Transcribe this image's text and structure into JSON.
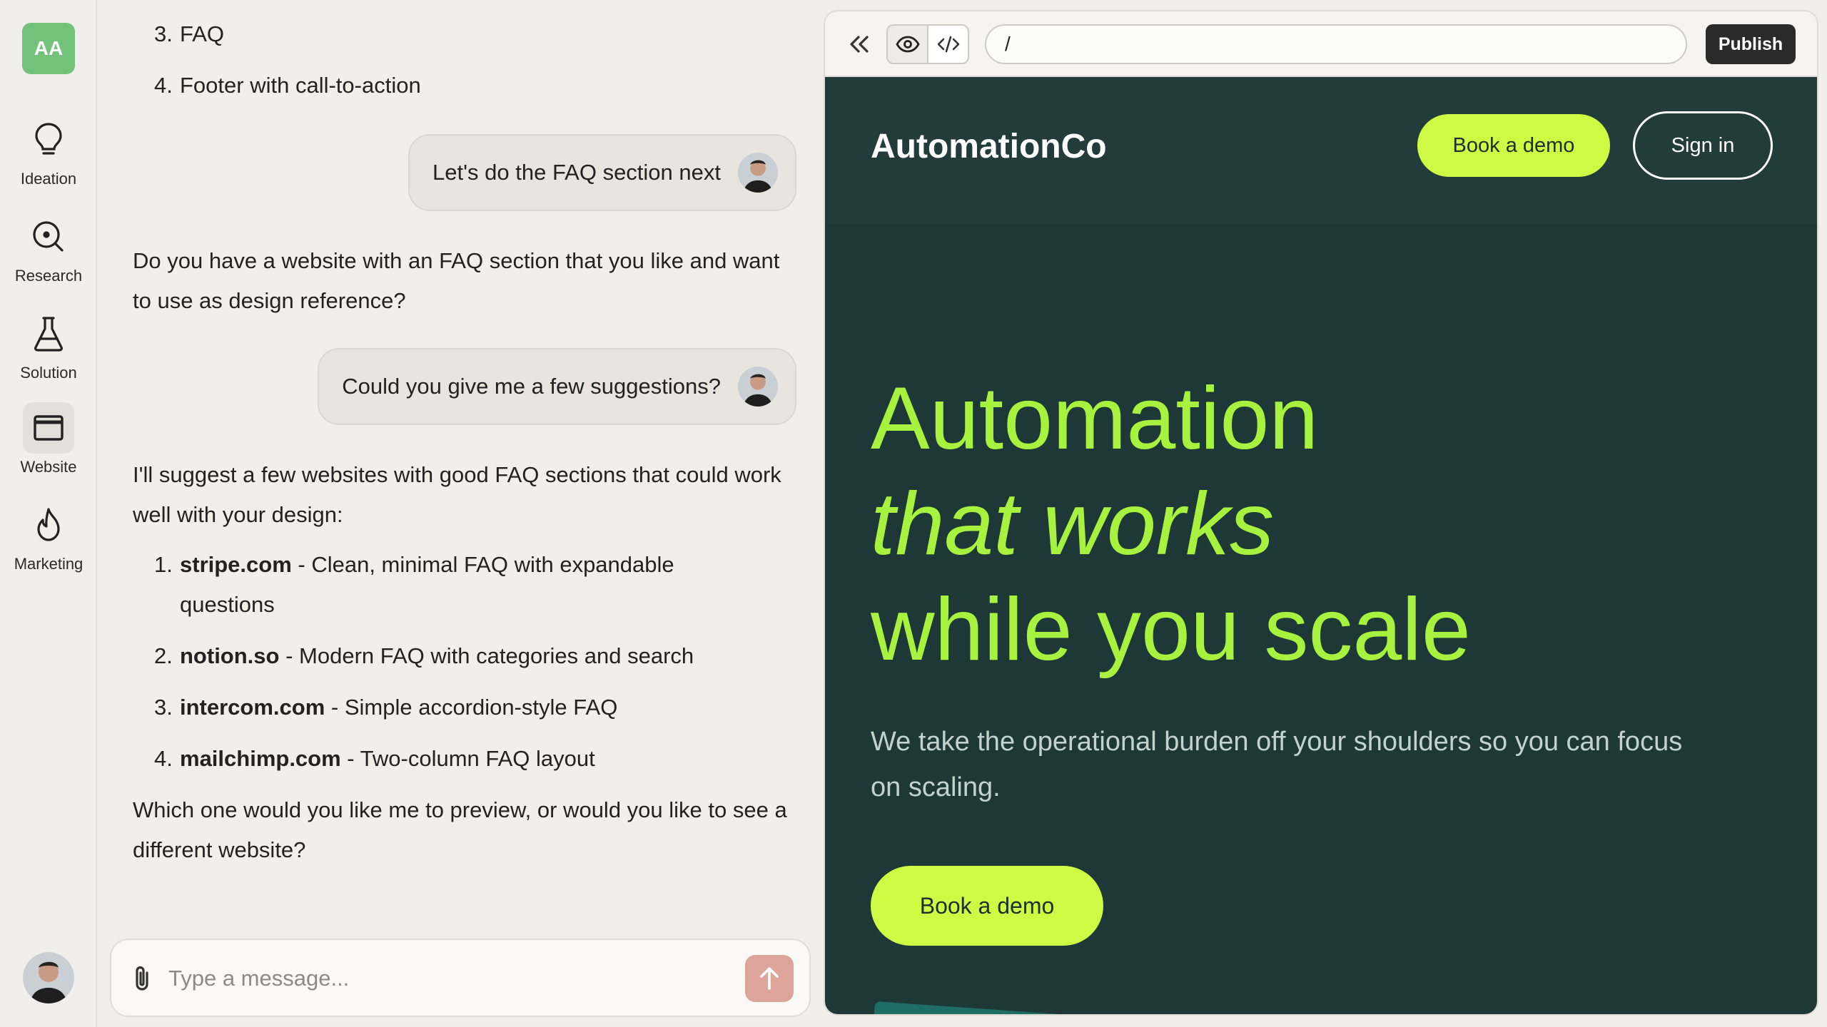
{
  "app": {
    "avatar_initials": "AA",
    "nav": [
      {
        "label": "Ideation",
        "icon": "lightbulb-icon"
      },
      {
        "label": "Research",
        "icon": "search-icon"
      },
      {
        "label": "Solution",
        "icon": "flask-icon"
      },
      {
        "label": "Website",
        "icon": "browser-window-icon",
        "active": true
      },
      {
        "label": "Marketing",
        "icon": "flame-icon"
      }
    ]
  },
  "chat": {
    "top_list": [
      {
        "num": "3.",
        "text": "FAQ"
      },
      {
        "num": "4.",
        "text": "Footer with call-to-action"
      }
    ],
    "user_msg_1": "Let's do the FAQ section next",
    "assistant_msg_1": "Do you have a website with an FAQ section that you like and want to use as design reference?",
    "user_msg_2": "Could you give me a few suggestions?",
    "assistant_msg_2": "I'll suggest a few websites with good FAQ sections that could work well with your design:",
    "suggestions": [
      {
        "num": "1.",
        "site": "stripe.com",
        "desc": " - Clean, minimal FAQ with expandable",
        "desc2": "questions"
      },
      {
        "num": "2.",
        "site": "notion.so",
        "desc": " - Modern FAQ with categories and search"
      },
      {
        "num": "3.",
        "site": "intercom.com",
        "desc": " - Simple accordion-style FAQ"
      },
      {
        "num": "4.",
        "site": "mailchimp.com",
        "desc": " - Two-column FAQ layout"
      }
    ],
    "assistant_msg_3": "Which one would you like me to preview, or would you like to see a different website?",
    "composer_placeholder": "Type a message..."
  },
  "preview": {
    "url": "/",
    "publish_label": "Publish",
    "site": {
      "brand": "AutomationCo",
      "nav_demo": "Book a demo",
      "nav_signin": "Sign in",
      "hero_line1": "Automation",
      "hero_line2": "that works",
      "hero_line3": "while you scale",
      "hero_sub": "We take the operational burden off your shoulders so you can focus on scaling.",
      "hero_cta": "Book a demo"
    }
  },
  "colors": {
    "brand_green": "#73c27b",
    "site_bg": "#1e3837",
    "lime": "#cdfb43",
    "hero_green": "#a6f23f",
    "send_button": "#dda49a"
  }
}
